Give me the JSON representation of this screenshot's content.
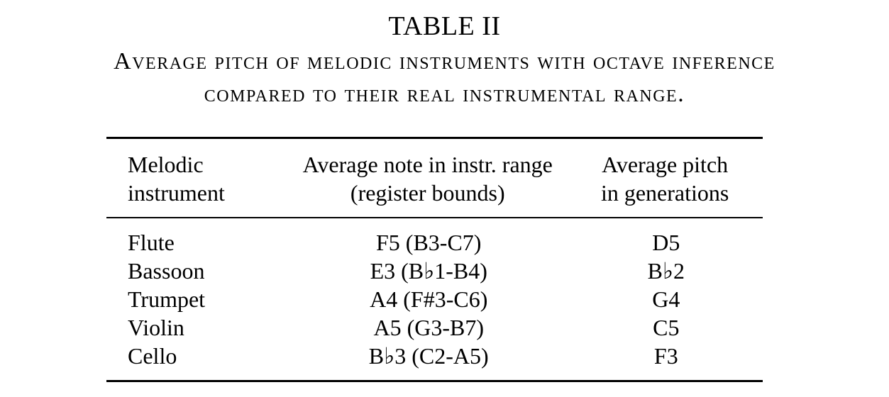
{
  "table": {
    "number": "TABLE II",
    "caption_line1": "Average pitch of melodic instruments with octave inference",
    "caption_line2": "compared to their real instrumental range.",
    "headers": [
      {
        "line1": "Melodic",
        "line2": "instrument"
      },
      {
        "line1": "Average note in instr. range",
        "line2": "(register bounds)"
      },
      {
        "line1": "Average pitch",
        "line2": "in generations"
      }
    ],
    "rows": [
      {
        "instrument": "Flute",
        "range": "F5 (B3-C7)",
        "pitch": "D5"
      },
      {
        "instrument": "Bassoon",
        "range": "E3 (B♭1-B4)",
        "pitch": "B♭2"
      },
      {
        "instrument": "Trumpet",
        "range": "A4 (F#3-C6)",
        "pitch": "G4"
      },
      {
        "instrument": "Violin",
        "range": "A5 (G3-B7)",
        "pitch": "C5"
      },
      {
        "instrument": "Cello",
        "range": "B♭3 (C2-A5)",
        "pitch": "F3"
      }
    ]
  }
}
